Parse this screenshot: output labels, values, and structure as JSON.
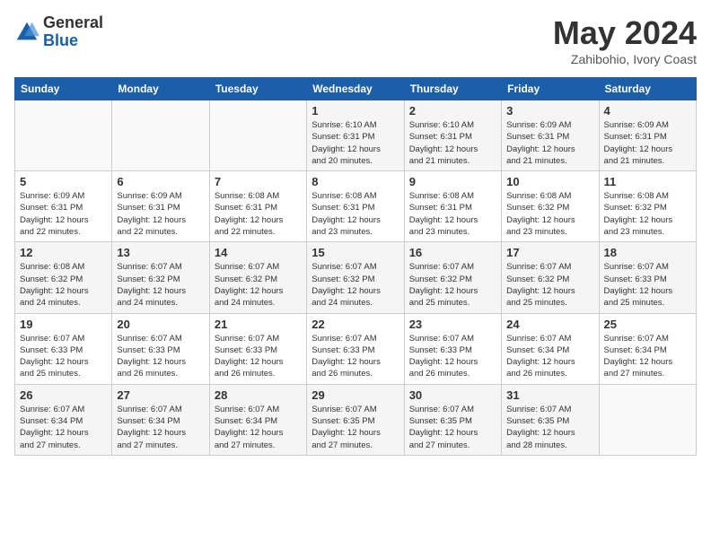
{
  "header": {
    "logo_general": "General",
    "logo_blue": "Blue",
    "month_title": "May 2024",
    "location": "Zahibohio, Ivory Coast"
  },
  "weekdays": [
    "Sunday",
    "Monday",
    "Tuesday",
    "Wednesday",
    "Thursday",
    "Friday",
    "Saturday"
  ],
  "weeks": [
    [
      {
        "day": "",
        "info": ""
      },
      {
        "day": "",
        "info": ""
      },
      {
        "day": "",
        "info": ""
      },
      {
        "day": "1",
        "info": "Sunrise: 6:10 AM\nSunset: 6:31 PM\nDaylight: 12 hours\nand 20 minutes."
      },
      {
        "day": "2",
        "info": "Sunrise: 6:10 AM\nSunset: 6:31 PM\nDaylight: 12 hours\nand 21 minutes."
      },
      {
        "day": "3",
        "info": "Sunrise: 6:09 AM\nSunset: 6:31 PM\nDaylight: 12 hours\nand 21 minutes."
      },
      {
        "day": "4",
        "info": "Sunrise: 6:09 AM\nSunset: 6:31 PM\nDaylight: 12 hours\nand 21 minutes."
      }
    ],
    [
      {
        "day": "5",
        "info": "Sunrise: 6:09 AM\nSunset: 6:31 PM\nDaylight: 12 hours\nand 22 minutes."
      },
      {
        "day": "6",
        "info": "Sunrise: 6:09 AM\nSunset: 6:31 PM\nDaylight: 12 hours\nand 22 minutes."
      },
      {
        "day": "7",
        "info": "Sunrise: 6:08 AM\nSunset: 6:31 PM\nDaylight: 12 hours\nand 22 minutes."
      },
      {
        "day": "8",
        "info": "Sunrise: 6:08 AM\nSunset: 6:31 PM\nDaylight: 12 hours\nand 23 minutes."
      },
      {
        "day": "9",
        "info": "Sunrise: 6:08 AM\nSunset: 6:31 PM\nDaylight: 12 hours\nand 23 minutes."
      },
      {
        "day": "10",
        "info": "Sunrise: 6:08 AM\nSunset: 6:32 PM\nDaylight: 12 hours\nand 23 minutes."
      },
      {
        "day": "11",
        "info": "Sunrise: 6:08 AM\nSunset: 6:32 PM\nDaylight: 12 hours\nand 23 minutes."
      }
    ],
    [
      {
        "day": "12",
        "info": "Sunrise: 6:08 AM\nSunset: 6:32 PM\nDaylight: 12 hours\nand 24 minutes."
      },
      {
        "day": "13",
        "info": "Sunrise: 6:07 AM\nSunset: 6:32 PM\nDaylight: 12 hours\nand 24 minutes."
      },
      {
        "day": "14",
        "info": "Sunrise: 6:07 AM\nSunset: 6:32 PM\nDaylight: 12 hours\nand 24 minutes."
      },
      {
        "day": "15",
        "info": "Sunrise: 6:07 AM\nSunset: 6:32 PM\nDaylight: 12 hours\nand 24 minutes."
      },
      {
        "day": "16",
        "info": "Sunrise: 6:07 AM\nSunset: 6:32 PM\nDaylight: 12 hours\nand 25 minutes."
      },
      {
        "day": "17",
        "info": "Sunrise: 6:07 AM\nSunset: 6:32 PM\nDaylight: 12 hours\nand 25 minutes."
      },
      {
        "day": "18",
        "info": "Sunrise: 6:07 AM\nSunset: 6:33 PM\nDaylight: 12 hours\nand 25 minutes."
      }
    ],
    [
      {
        "day": "19",
        "info": "Sunrise: 6:07 AM\nSunset: 6:33 PM\nDaylight: 12 hours\nand 25 minutes."
      },
      {
        "day": "20",
        "info": "Sunrise: 6:07 AM\nSunset: 6:33 PM\nDaylight: 12 hours\nand 26 minutes."
      },
      {
        "day": "21",
        "info": "Sunrise: 6:07 AM\nSunset: 6:33 PM\nDaylight: 12 hours\nand 26 minutes."
      },
      {
        "day": "22",
        "info": "Sunrise: 6:07 AM\nSunset: 6:33 PM\nDaylight: 12 hours\nand 26 minutes."
      },
      {
        "day": "23",
        "info": "Sunrise: 6:07 AM\nSunset: 6:33 PM\nDaylight: 12 hours\nand 26 minutes."
      },
      {
        "day": "24",
        "info": "Sunrise: 6:07 AM\nSunset: 6:34 PM\nDaylight: 12 hours\nand 26 minutes."
      },
      {
        "day": "25",
        "info": "Sunrise: 6:07 AM\nSunset: 6:34 PM\nDaylight: 12 hours\nand 27 minutes."
      }
    ],
    [
      {
        "day": "26",
        "info": "Sunrise: 6:07 AM\nSunset: 6:34 PM\nDaylight: 12 hours\nand 27 minutes."
      },
      {
        "day": "27",
        "info": "Sunrise: 6:07 AM\nSunset: 6:34 PM\nDaylight: 12 hours\nand 27 minutes."
      },
      {
        "day": "28",
        "info": "Sunrise: 6:07 AM\nSunset: 6:34 PM\nDaylight: 12 hours\nand 27 minutes."
      },
      {
        "day": "29",
        "info": "Sunrise: 6:07 AM\nSunset: 6:35 PM\nDaylight: 12 hours\nand 27 minutes."
      },
      {
        "day": "30",
        "info": "Sunrise: 6:07 AM\nSunset: 6:35 PM\nDaylight: 12 hours\nand 27 minutes."
      },
      {
        "day": "31",
        "info": "Sunrise: 6:07 AM\nSunset: 6:35 PM\nDaylight: 12 hours\nand 28 minutes."
      },
      {
        "day": "",
        "info": ""
      }
    ]
  ]
}
